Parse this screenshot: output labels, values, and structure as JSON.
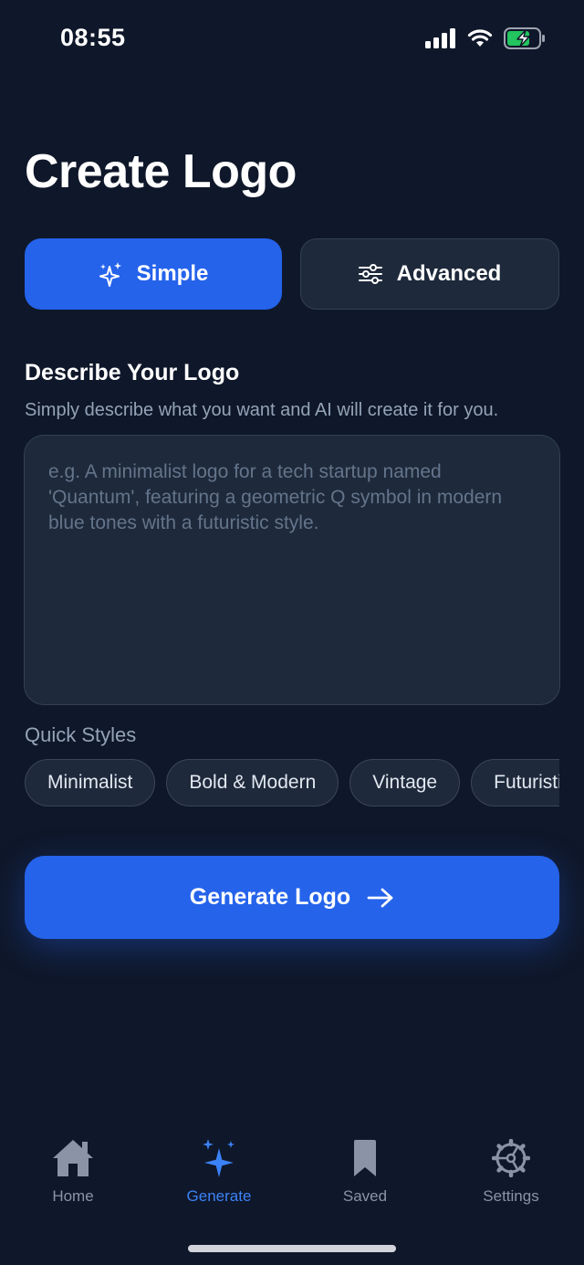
{
  "status_bar": {
    "time": "08:55"
  },
  "page": {
    "title": "Create Logo"
  },
  "mode_tabs": [
    {
      "label": "Simple",
      "icon": "sparkles-icon",
      "active": true
    },
    {
      "label": "Advanced",
      "icon": "sliders-icon",
      "active": false
    }
  ],
  "describe": {
    "title": "Describe Your Logo",
    "subtitle": "Simply describe what you want and AI will create it for you.",
    "placeholder": "e.g. A minimalist logo for a tech startup named 'Quantum', featuring a geometric Q symbol in modern blue tones with a futuristic style.",
    "value": ""
  },
  "quick_styles": {
    "label": "Quick Styles",
    "items": [
      "Minimalist",
      "Bold & Modern",
      "Vintage",
      "Futuristic"
    ]
  },
  "generate": {
    "label": "Generate Logo",
    "icon": "arrow-right-icon"
  },
  "tab_bar": [
    {
      "label": "Home",
      "icon": "home-icon",
      "active": false
    },
    {
      "label": "Generate",
      "icon": "sparkles-icon",
      "active": true
    },
    {
      "label": "Saved",
      "icon": "bookmark-icon",
      "active": false
    },
    {
      "label": "Settings",
      "icon": "gear-icon",
      "active": false
    }
  ],
  "colors": {
    "background": "#0f172a",
    "surface": "#1e293b",
    "accent": "#2563eb",
    "muted_text": "#94a3b8",
    "battery_green": "#22c55e"
  }
}
